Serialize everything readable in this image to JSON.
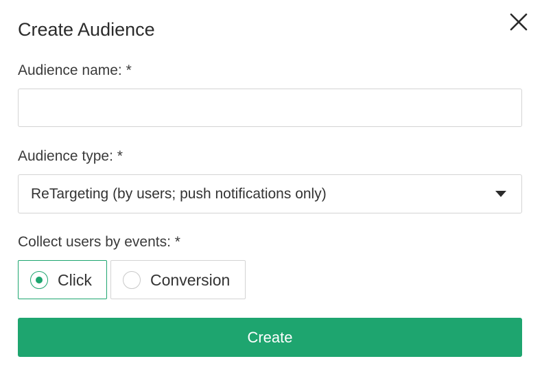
{
  "dialog": {
    "title": "Create Audience",
    "close_icon": "close-icon"
  },
  "form": {
    "name_label": "Audience name: *",
    "name_value": "",
    "name_placeholder": "",
    "type_label": "Audience type: *",
    "type_value": "ReTargeting (by users; push notifications only)",
    "events_label": "Collect users by events: *",
    "events_options": [
      {
        "label": "Click",
        "selected": true
      },
      {
        "label": "Conversion",
        "selected": false
      }
    ],
    "submit_label": "Create"
  },
  "colors": {
    "accent": "#1ea56f",
    "border": "#d3d3d3",
    "text": "#333333"
  }
}
